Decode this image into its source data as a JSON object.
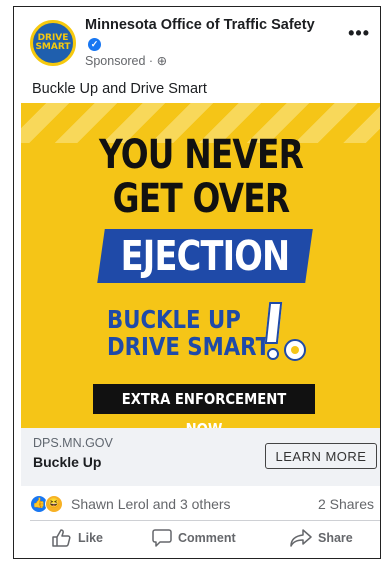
{
  "post": {
    "page_name": "Minnesota Office of Traffic Safety",
    "sponsored": "Sponsored · ",
    "more": "•••",
    "caption": "Buckle Up and Drive Smart",
    "avatar": {
      "line1": "DRIVE",
      "line2": "SMART"
    }
  },
  "creative": {
    "headline_line1": "YOU NEVER",
    "headline_line2": "GET OVER",
    "headline_line3": "EJECTION",
    "logo_line1": "BUCKLE UP",
    "logo_line2": "DRIVE SMART",
    "banner": "EXTRA ENFORCEMENT NOW",
    "colors": {
      "background": "#f5c517",
      "accent_blue": "#1f4aa8",
      "banner": "#111111"
    }
  },
  "link": {
    "domain": "DPS.MN.GOV",
    "title": "Buckle Up",
    "cta": "LEARN MORE"
  },
  "engagement": {
    "reactions_text": "Shawn Lerol and 3 others",
    "shares": "2 Shares",
    "reaction_icons": [
      "like-reaction-icon",
      "haha-reaction-icon"
    ]
  },
  "actions": {
    "like": "Like",
    "comment": "Comment",
    "share": "Share"
  }
}
